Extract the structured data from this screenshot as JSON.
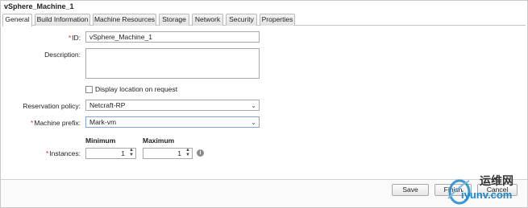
{
  "window": {
    "title": "vSphere_Machine_1"
  },
  "tabs": [
    {
      "label": "General",
      "active": true
    },
    {
      "label": "Build Information",
      "active": false
    },
    {
      "label": "Machine Resources",
      "active": false
    },
    {
      "label": "Storage",
      "active": false
    },
    {
      "label": "Network",
      "active": false
    },
    {
      "label": "Security",
      "active": false
    },
    {
      "label": "Properties",
      "active": false
    }
  ],
  "form": {
    "id_label": "ID:",
    "id_value": "vSphere_Machine_1",
    "description_label": "Description:",
    "description_value": "",
    "display_location_label": "Display location on request",
    "display_location_checked": false,
    "reservation_policy_label": "Reservation policy:",
    "reservation_policy_value": "Netcraft-RP",
    "machine_prefix_label": "Machine prefix:",
    "machine_prefix_value": "Mark-vm",
    "instances_label": "Instances:",
    "minimum_header": "Minimum",
    "maximum_header": "Maximum",
    "minimum_value": "1",
    "maximum_value": "1",
    "required_marker": "*"
  },
  "footer": {
    "save_label": "Save",
    "finish_label": "Finish",
    "cancel_label": "Cancel"
  },
  "watermark": {
    "text": "运维网",
    "url": "iyunv.com"
  },
  "colors": {
    "required": "#d32f2f",
    "focus_border": "#7fa6d6",
    "watermark_blue": "#1c87c9"
  },
  "icons": {
    "dropdown": "chevron-down-icon",
    "spinner": "spinner-arrows-icon",
    "info": "info-icon"
  }
}
